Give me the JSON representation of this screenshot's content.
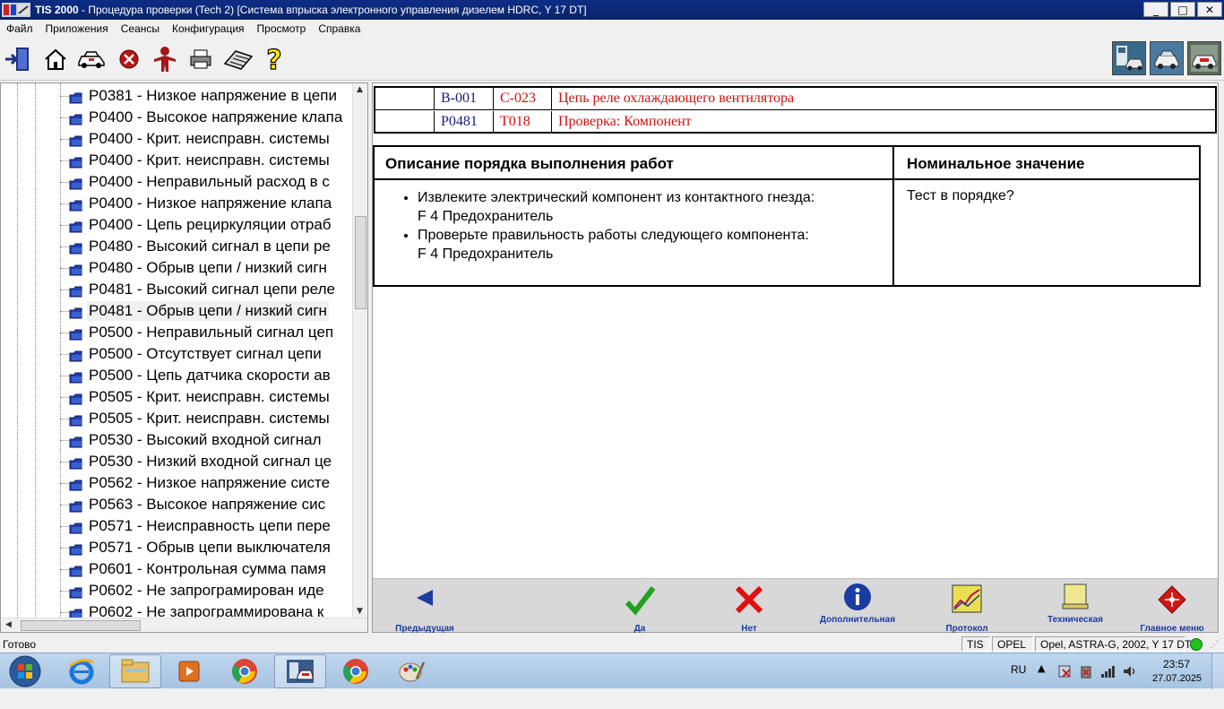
{
  "window": {
    "title_bold": "TIS 2000",
    "title_rest": " - Процедура проверки (Tech 2) [Система впрыска электронного управления дизелем HDRC, Y 17 DT]",
    "min": "_",
    "max": "□",
    "close": "✕"
  },
  "menu": [
    "Файл",
    "Приложения",
    "Сеансы",
    "Конфигурация",
    "Просмотр",
    "Справка"
  ],
  "tree": {
    "items": [
      "P0381 - Низкое напряжение в цепи",
      "P0400 - Высокое напряжение клапа",
      "P0400 - Крит. неисправн. системы",
      "P0400 - Крит. неисправн. системы",
      "P0400 - Неправильный расход в с",
      "P0400 - Низкое напряжение клапа",
      "P0400 - Цепь рециркуляции отраб",
      "P0480 - Высокий сигнал в цепи ре",
      "P0480 - Обрыв цепи / низкий сигн",
      "P0481 - Высокий сигнал цепи реле",
      "P0481 - Обрыв цепи / низкий сигн",
      "P0500 - Неправильный сигнал цеп",
      "P0500 - Отсутствует сигнал цепи",
      "P0500 - Цепь датчика скорости ав",
      "P0505 - Крит. неисправн. системы",
      "P0505 - Крит. неисправн. системы",
      "P0530 - Высокий входной сигнал",
      "P0530 - Низкий входной сигнал це",
      "P0562 - Низкое напряжение систе",
      "P0563 - Высокое напряжение сис",
      "P0571 - Неисправность цепи пере",
      "P0571 - Обрыв цепи выключателя",
      "P0601 - Контрольная сумма памя",
      "P0602 - Не запрограмирован иде",
      "P0602 - Не запрограммирована к"
    ],
    "selected_index": 10
  },
  "header_table": {
    "row1": {
      "col2": "B-001",
      "col3": "C-023",
      "col4": "Цепь реле охлаждающего вентилятора"
    },
    "row2": {
      "col2": "P0481",
      "col3": "T018",
      "col4": "Проверка: Компонент"
    }
  },
  "work_table": {
    "head_description": "Описание порядка выполнения работ",
    "head_nominal": "Номинальное значение",
    "steps": [
      {
        "line1": "Извлеките электрический компонент из контактного гнезда:",
        "line2": "F 4 Предохранитель"
      },
      {
        "line1": "Проверьте правильность работы следующего компонента:",
        "line2": "F 4 Предохранитель"
      }
    ],
    "nominal": "Тест в порядке?"
  },
  "nav_buttons": {
    "prev": "Предыдущая",
    "yes": "Да",
    "no": "Нет",
    "more": "Дополнительная",
    "protocol": "Протокол",
    "tech": "Техническая",
    "main_menu": "Главное меню"
  },
  "status": {
    "ready": "Готово",
    "tis": "TIS",
    "opel": "OPEL",
    "vehicle": "Opel, ASTRA-G, 2002, Y 17 DT"
  },
  "taskbar": {
    "lang": "RU",
    "time": "23:57",
    "date": "27.07.2025"
  },
  "colors": {
    "title_bg": "#0a246a",
    "header_red": "#d01010",
    "header_blue": "#1a1a80",
    "nav_blue": "#1b3ca0"
  }
}
